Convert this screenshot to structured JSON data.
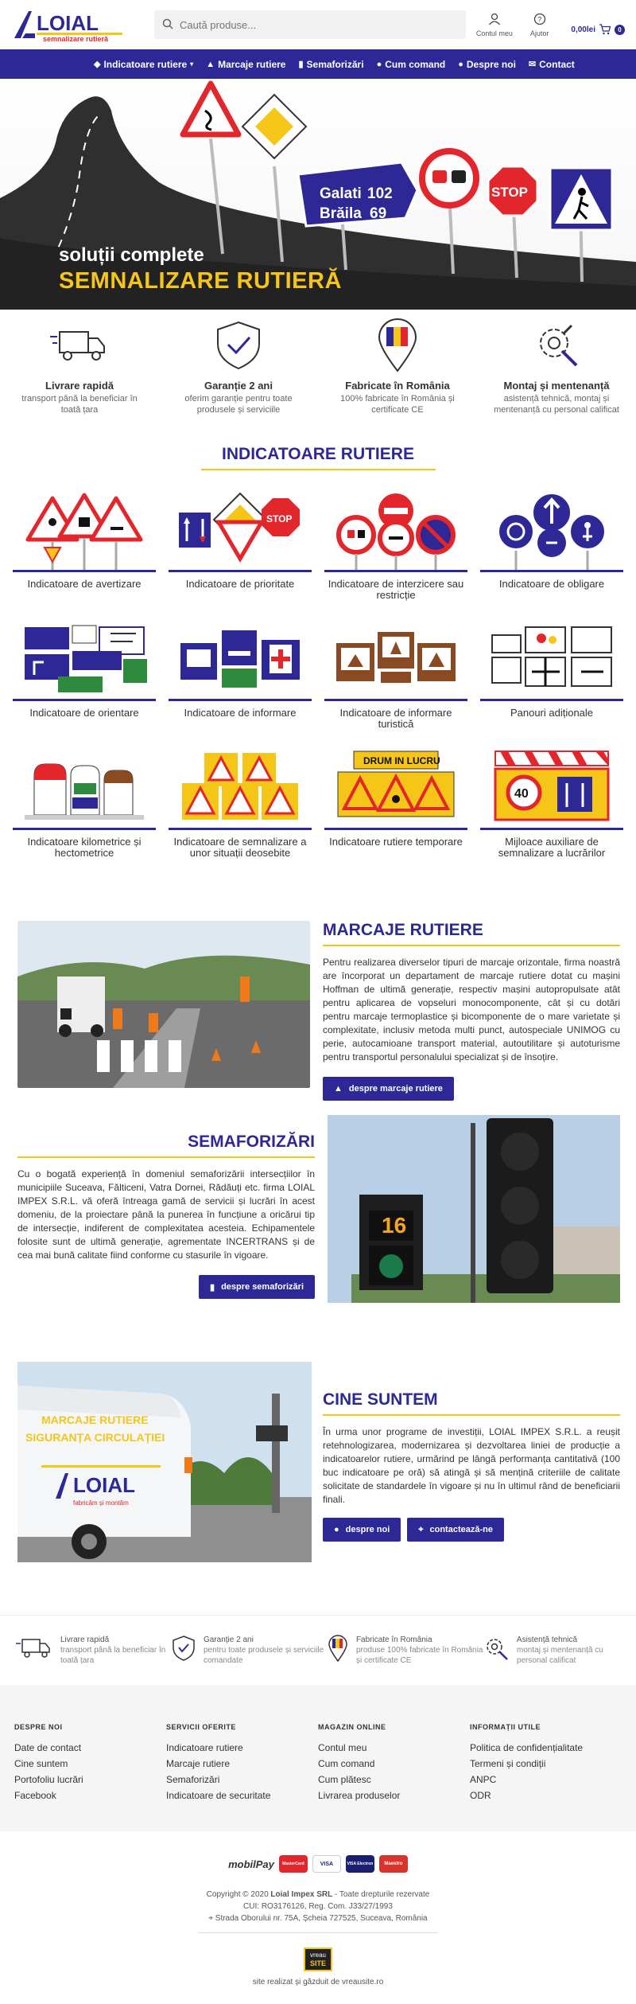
{
  "header": {
    "logo_text": "LOIAL",
    "logo_tagline": "semnalizare rutieră",
    "search_placeholder": "Caută produse...",
    "account_label": "Contul meu",
    "help_label": "Ajutor",
    "cart_total": "0,00lei",
    "cart_count": "0"
  },
  "nav": {
    "items": [
      {
        "label": "Indicatoare rutiere",
        "icon": "sign-icon"
      },
      {
        "label": "Marcaje rutiere",
        "icon": "road-icon"
      },
      {
        "label": "Semaforizări",
        "icon": "traffic-light-icon"
      },
      {
        "label": "Cum comand",
        "icon": "question-icon"
      },
      {
        "label": "Despre noi",
        "icon": "info-icon"
      },
      {
        "label": "Contact",
        "icon": "mail-icon"
      }
    ]
  },
  "hero": {
    "line1": "soluții complete",
    "line2": "SEMNALIZARE RUTIERĂ",
    "sign_text": {
      "city1": "Galati",
      "num1": "102",
      "city2": "Brăila",
      "num2": "69",
      "stop": "STOP"
    }
  },
  "features": [
    {
      "title": "Livrare rapidă",
      "desc": "transport până la beneficiar în toată țara",
      "icon": "truck-icon"
    },
    {
      "title": "Garanție 2 ani",
      "desc": "oferim garanție pentru toate produsele și serviciile",
      "icon": "shield-check-icon"
    },
    {
      "title": "Fabricate în România",
      "desc": "100% fabricate în România și certificate CE",
      "icon": "map-pin-flag-icon"
    },
    {
      "title": "Montaj și mentenanță",
      "desc": "asistență tehnică, montaj și mentenanță cu personal calificat",
      "icon": "tools-icon"
    }
  ],
  "indicatoare": {
    "title": "INDICATOARE RUTIERE",
    "categories": [
      "Indicatoare de avertizare",
      "Indicatoare de prioritate",
      "Indicatoare de interzicere sau restricție",
      "Indicatoare de obligare",
      "Indicatoare de orientare",
      "Indicatoare de informare",
      "Indicatoare de informare turistică",
      "Panouri adiționale",
      "Indicatoare kilometrice și hectometrice",
      "Indicatoare de semnalizare a unor situații deosebite",
      "Indicatoare rutiere temporare",
      "Mijloace auxiliare de semnalizare a lucrărilor"
    ]
  },
  "marcaje": {
    "title": "MARCAJE RUTIERE",
    "body": "Pentru realizarea diverselor tipuri de marcaje orizontale, firma noastră are încorporat un departament de marcaje rutiere dotat cu mașini Hoffman de ultimă generație, respectiv mașini autopropulsate atât pentru aplicarea de vopseluri monocomponente, cât și cu dotări pentru marcaje termoplastice și bicomponente de o mare varietate și complexitate, inclusiv metoda multi punct, autospeciale UNIMOG cu perie, autocamioane transport material, autoutilitare și autoturisme pentru transportul personalului specializat și de însoțire.",
    "button": "despre marcaje rutiere"
  },
  "semaforizari": {
    "title": "SEMAFORIZĂRI",
    "body": "Cu o bogată experiență în domeniul semaforizării intersecțiilor în municipiile Suceava, Fălticeni, Vatra Dornei, Rădăuți etc. firma LOIAL IMPEX S.R.L. vă oferă întreaga gamă de servicii și lucrări în acest domeniu, de la proiectare până la punerea în funcțiune a oricărui tip de intersecție, indiferent de complexitatea acesteia. Echipamentele folosite sunt de ultimă generație, agrementate INCERTRANS și de cea mai bună calitate fiind conforme cu stasurile în vigoare.",
    "button": "despre semaforizări",
    "counter": "16"
  },
  "cine": {
    "title": "CINE SUNTEM",
    "body": "În urma unor programe de investiții, LOIAL IMPEX S.R.L. a reușit retehnologizarea, modernizarea și dezvoltarea liniei de producție a indicatoarelor rutiere, urmărind pe lângă performanța cantitativă (100 buc indicatoare pe oră) să atingă și să mențină criteriile de calitate solicitate de standardele în vigoare și nu în ultimul rând de beneficiarii finali.",
    "button1": "despre noi",
    "button2": "contactează-ne",
    "van_text1": "MARCAJE RUTIERE",
    "van_text2": "SIGURANȚA CIRCULAȚIEI",
    "van_logo": "LOIAL",
    "van_sub": "fabricăm și montăm"
  },
  "features2": [
    {
      "title": "Livrare rapidă",
      "desc": "transport până la beneficiar în toată țara"
    },
    {
      "title": "Garanție 2 ani",
      "desc": "pentru toate produsele și serviciile comandate"
    },
    {
      "title": "Fabricate în România",
      "desc": "produse 100% fabricate în România și certificate CE"
    },
    {
      "title": "Asistență tehnică",
      "desc": "montaj și mentenanță cu personal calificat"
    }
  ],
  "footer": {
    "cols": [
      {
        "heading": "DESPRE NOI",
        "links": [
          "Date de contact",
          "Cine suntem",
          "Portofoliu lucrări",
          "Facebook"
        ]
      },
      {
        "heading": "SERVICII OFERITE",
        "links": [
          "Indicatoare rutiere",
          "Marcaje rutiere",
          "Semaforizări",
          "Indicatoare de securitate"
        ]
      },
      {
        "heading": "MAGAZIN ONLINE",
        "links": [
          "Contul meu",
          "Cum comand",
          "Cum plătesc",
          "Livrarea produselor"
        ]
      },
      {
        "heading": "INFORMAȚII UTILE",
        "links": [
          "Politica de confidențialitate",
          "Termeni și condiții",
          "ANPC",
          "ODR"
        ]
      }
    ],
    "payment": {
      "mobilpay": "mobilPay",
      "cards": [
        "MasterCard",
        "VISA",
        "VISA Electron",
        "Maestro"
      ]
    },
    "copyright": "Copyright © 2020",
    "company": "Loial Impex SRL",
    "rights": " - Toate drepturile rezervate",
    "cui": "CUI: RO3176126, Reg. Com. J33/27/1993",
    "address": "Strada Oborului nr. 75A, Șcheia 727525, Suceava, România",
    "badge_top": "vreau",
    "badge_bottom": "SITE",
    "credit": "site realizat și găzduit de vreausite.ro"
  },
  "colors": {
    "primary": "#2d2896",
    "accent": "#f5c518",
    "red": "#e3262b"
  }
}
